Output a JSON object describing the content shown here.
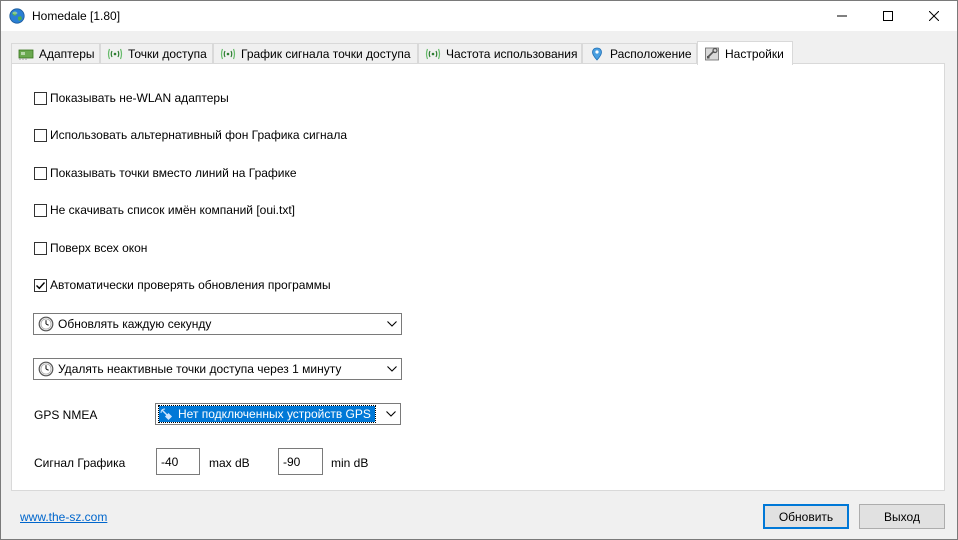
{
  "window": {
    "title": "Homedale [1.80]"
  },
  "tabs": [
    {
      "label": "Адаптеры",
      "icon": "network-card-icon"
    },
    {
      "label": "Точки доступа",
      "icon": "wifi-signal-icon"
    },
    {
      "label": "График сигнала точки доступа",
      "icon": "wifi-signal-icon"
    },
    {
      "label": "Частота использования",
      "icon": "wifi-signal-icon"
    },
    {
      "label": "Расположение",
      "icon": "location-pin-icon"
    },
    {
      "label": "Настройки",
      "icon": "settings-icon",
      "active": true
    }
  ],
  "settings": {
    "checkboxes": [
      {
        "label": "Показывать не-WLAN адаптеры",
        "checked": false
      },
      {
        "label": "Использовать альтернативный фон Графика сигнала",
        "checked": false
      },
      {
        "label": "Показывать точки вместо линий на Графике",
        "checked": false
      },
      {
        "label": "Не скачивать список имён компаний [oui.txt]",
        "checked": false
      },
      {
        "label": "Поверх всех окон",
        "checked": false
      },
      {
        "label": "Автоматически проверять обновления программы",
        "checked": true
      }
    ],
    "refresh_combo": {
      "value": "Обновлять каждую секунду",
      "icon": "clock-icon"
    },
    "remove_combo": {
      "value": "Удалять неактивные точки доступа через 1 минуту",
      "icon": "clock-icon"
    },
    "gps": {
      "label": "GPS NMEA",
      "value": "Нет подключенных устройств GPS",
      "icon": "satellite-icon"
    },
    "signal": {
      "label": "Сигнал Графика",
      "max_value": "-40",
      "max_unit": "max dB",
      "min_value": "-90",
      "min_unit": "min dB"
    }
  },
  "footer": {
    "link": "www.the-sz.com",
    "refresh_button": "Обновить",
    "exit_button": "Выход"
  },
  "colors": {
    "accent": "#0078d7",
    "link": "#0066cc",
    "window_bg": "#f0f0f0",
    "panel_bg": "#ffffff"
  }
}
